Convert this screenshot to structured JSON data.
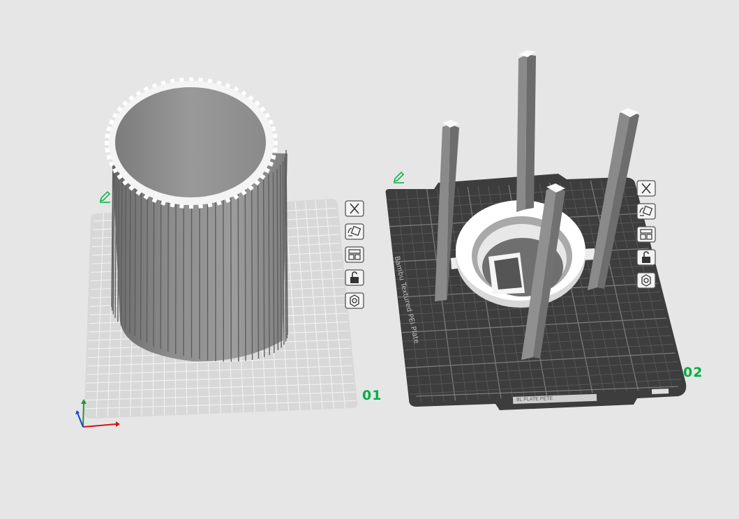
{
  "app": {
    "view": "3D prepare view",
    "accent_color": "#00ae42"
  },
  "plates": [
    {
      "number": "01",
      "bed": "plain",
      "object": "fluted-cylinder-vase",
      "tools": [
        {
          "icon": "close-icon",
          "name": "remove-plate"
        },
        {
          "icon": "auto-orient-icon",
          "name": "auto-orient"
        },
        {
          "icon": "arrange-icon",
          "name": "arrange"
        },
        {
          "icon": "lock-icon",
          "name": "lock-plate"
        },
        {
          "icon": "settings-icon",
          "name": "plate-settings"
        }
      ]
    },
    {
      "number": "02",
      "bed": "Textured PEI Plate",
      "plate_label": "Bambu Textured PEI Plate",
      "bottom_label": "BL  PLATE  PETE",
      "object": "ring-with-four-posts",
      "tools": [
        {
          "icon": "close-icon",
          "name": "remove-plate"
        },
        {
          "icon": "auto-orient-icon",
          "name": "auto-orient"
        },
        {
          "icon": "arrange-icon",
          "name": "arrange"
        },
        {
          "icon": "lock-icon",
          "name": "lock-plate"
        },
        {
          "icon": "settings-icon",
          "name": "plate-settings"
        }
      ]
    }
  ],
  "axes": {
    "x_color": "#d01616",
    "y_color": "#1b9c2e",
    "z_color": "#1a3ec9"
  }
}
